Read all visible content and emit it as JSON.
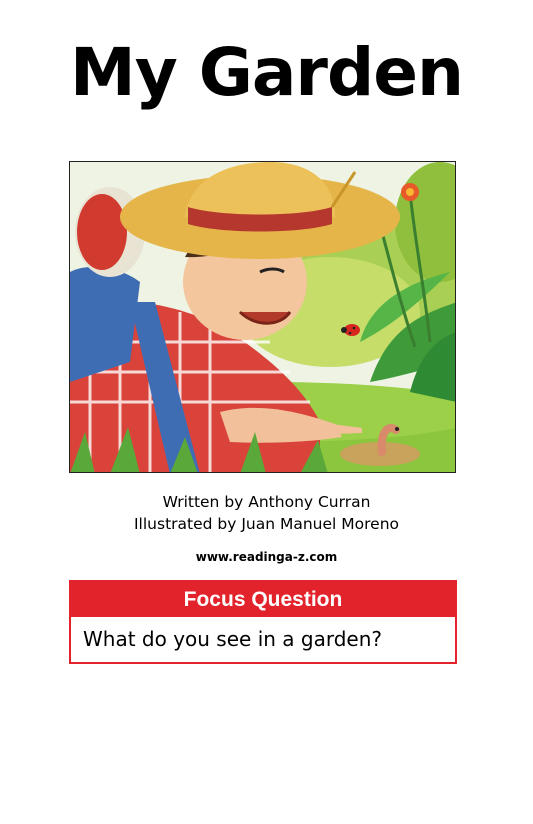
{
  "cover": {
    "title": "My Garden",
    "illustration_alt": "Boy in straw hat lying in the garden pointing at a worm"
  },
  "credits": {
    "author_line": "Written by Anthony Curran",
    "illustrator_line": "Illustrated by Juan Manuel Moreno"
  },
  "website": "www.readinga-z.com",
  "focus": {
    "header": "Focus Question",
    "question": "What do you see in a garden?"
  },
  "colors": {
    "focus_red": "#e3232b",
    "text": "#000000",
    "background": "#ffffff"
  }
}
